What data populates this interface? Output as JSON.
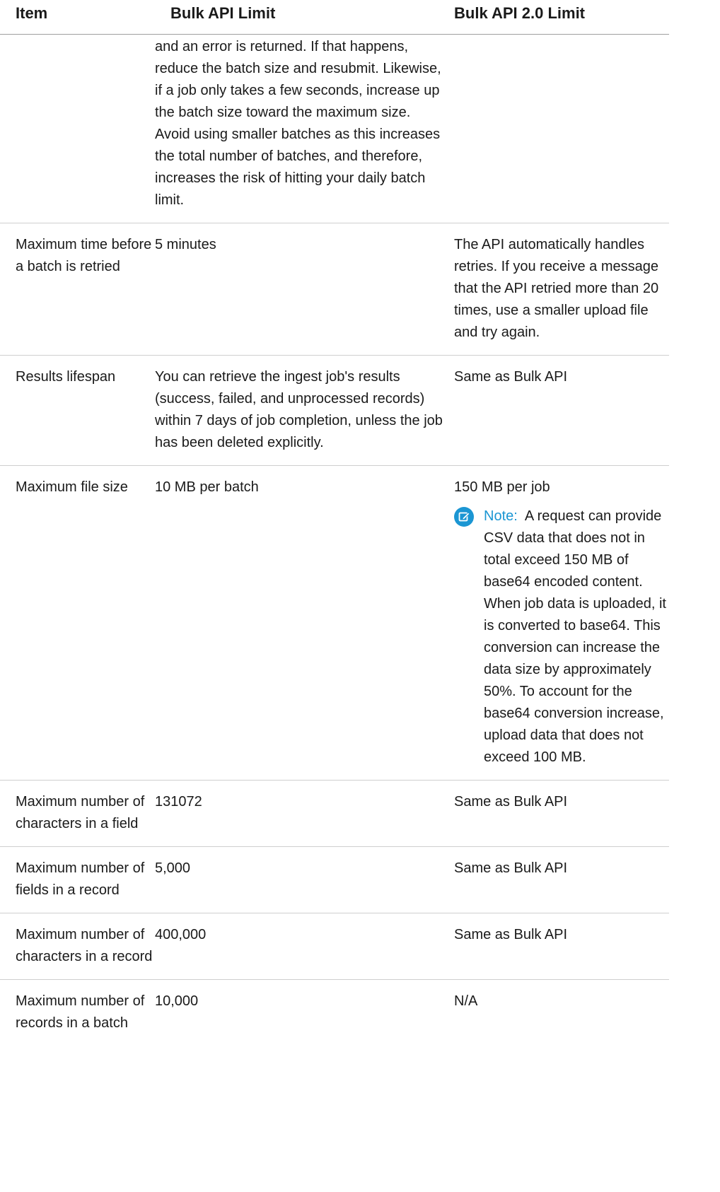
{
  "table": {
    "headers": [
      "Item",
      "Bulk API Limit",
      "Bulk API 2.0 Limit"
    ],
    "rows": [
      {
        "item": "",
        "bulk": "and an error is returned. If that happens, reduce the batch size and resubmit. Likewise, if a job only takes a few seconds, increase up the batch size toward the maximum size. Avoid using smaller batches as this increases the total number of batches, and therefore, increases the risk of hitting your daily batch limit.",
        "bulk2": ""
      },
      {
        "item": "Maximum time before a batch is retried",
        "bulk": "5 minutes",
        "bulk2": "The API automatically handles retries. If you receive a message that the API retried more than 20 times, use a smaller upload file and try again."
      },
      {
        "item": "Results lifespan",
        "bulk": "You can retrieve the ingest job's results (success, failed, and unprocessed records) within 7 days of job completion, unless the job has been deleted explicitly.",
        "bulk2": "Same as Bulk API"
      },
      {
        "item": "Maximum file size",
        "bulk": "10 MB per batch",
        "bulk2": "150 MB per job",
        "note_label": "Note:",
        "note_text": "A request can provide CSV data that does not in total exceed 150 MB of base64 encoded content. When job data is uploaded, it is converted to base64. This conversion can increase the data size by approximately 50%. To account for the base64 conversion increase, upload data that does not exceed 100 MB."
      },
      {
        "item": "Maximum number of characters in a field",
        "bulk": "131072",
        "bulk2": "Same as Bulk API"
      },
      {
        "item": "Maximum number of fields in a record",
        "bulk": "5,000",
        "bulk2": "Same as Bulk API"
      },
      {
        "item": "Maximum number of characters in a record",
        "bulk": "400,000",
        "bulk2": "Same as Bulk API"
      },
      {
        "item": "Maximum number of records in a batch",
        "bulk": "10,000",
        "bulk2": "N/A"
      }
    ]
  },
  "icons": {
    "note": "note-edit-icon"
  },
  "colors": {
    "note_accent": "#1b96d3"
  }
}
